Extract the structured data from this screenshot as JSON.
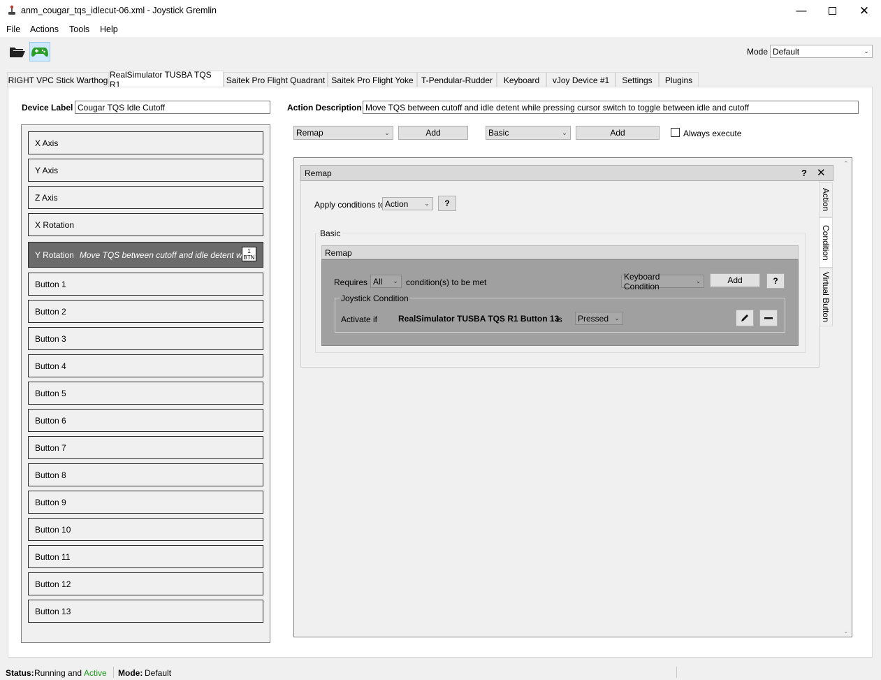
{
  "window": {
    "title": "anm_cougar_tqs_idlecut-06.xml - Joystick Gremlin"
  },
  "menu": [
    "File",
    "Actions",
    "Tools",
    "Help"
  ],
  "toolbar": {
    "mode_label": "Mode",
    "mode_value": "Default"
  },
  "tabs": [
    "RIGHT VPC Stick Warthog",
    "RealSimulator TUSBA TQS R1",
    "Saitek Pro Flight Quadrant",
    "Saitek Pro Flight Yoke",
    "T-Pendular-Rudder",
    "Keyboard",
    "vJoy Device #1",
    "Settings",
    "Plugins"
  ],
  "device": {
    "label_caption": "Device Label",
    "label_value": "Cougar TQS Idle Cutoff"
  },
  "inputs": [
    "X Axis",
    "Y Axis",
    "Z Axis",
    "X Rotation",
    "Y Rotation",
    "Button 1",
    "Button 2",
    "Button 3",
    "Button 4",
    "Button 5",
    "Button 6",
    "Button 7",
    "Button 8",
    "Button 9",
    "Button 10",
    "Button 11",
    "Button 12",
    "Button 13"
  ],
  "selected_input": {
    "desc": "Move TQS between cutoff and idle detent while p",
    "badge_top": "1",
    "badge_bottom": "BTN"
  },
  "action": {
    "desc_caption": "Action Description",
    "desc_value": "Move TQS between cutoff and idle detent while pressing cursor switch to toggle between idle and cutoff",
    "combo1": "Remap",
    "add1": "Add",
    "combo2": "Basic",
    "add2": "Add",
    "always_execute": "Always execute"
  },
  "remap": {
    "title": "Remap",
    "help": "?",
    "close": "✕",
    "apply_label": "Apply conditions to",
    "apply_value": "Action",
    "apply_help": "?",
    "group_title": "Basic",
    "inner_title": "Remap",
    "requires": "Requires",
    "requires_value": "All",
    "requires_suffix": "condition(s) to be met",
    "cond_type": "Keyboard Condition",
    "cond_add": "Add",
    "cond_help": "?",
    "jc_title": "Joystick Condition",
    "activate_if": "Activate if",
    "jc_input": "RealSimulator TUSBA TQS R1 Button 13",
    "is": "is",
    "state": "Pressed"
  },
  "side_tabs": [
    "Action",
    "Condition",
    "Virtual Button"
  ],
  "status": {
    "status_label": "Status:",
    "status_text": "Running and",
    "active": "Active",
    "mode_label": "Mode:",
    "mode_value": "Default"
  },
  "colors": {
    "active_green": "#1b9c1b",
    "selected_item": "#6b6b6b"
  }
}
